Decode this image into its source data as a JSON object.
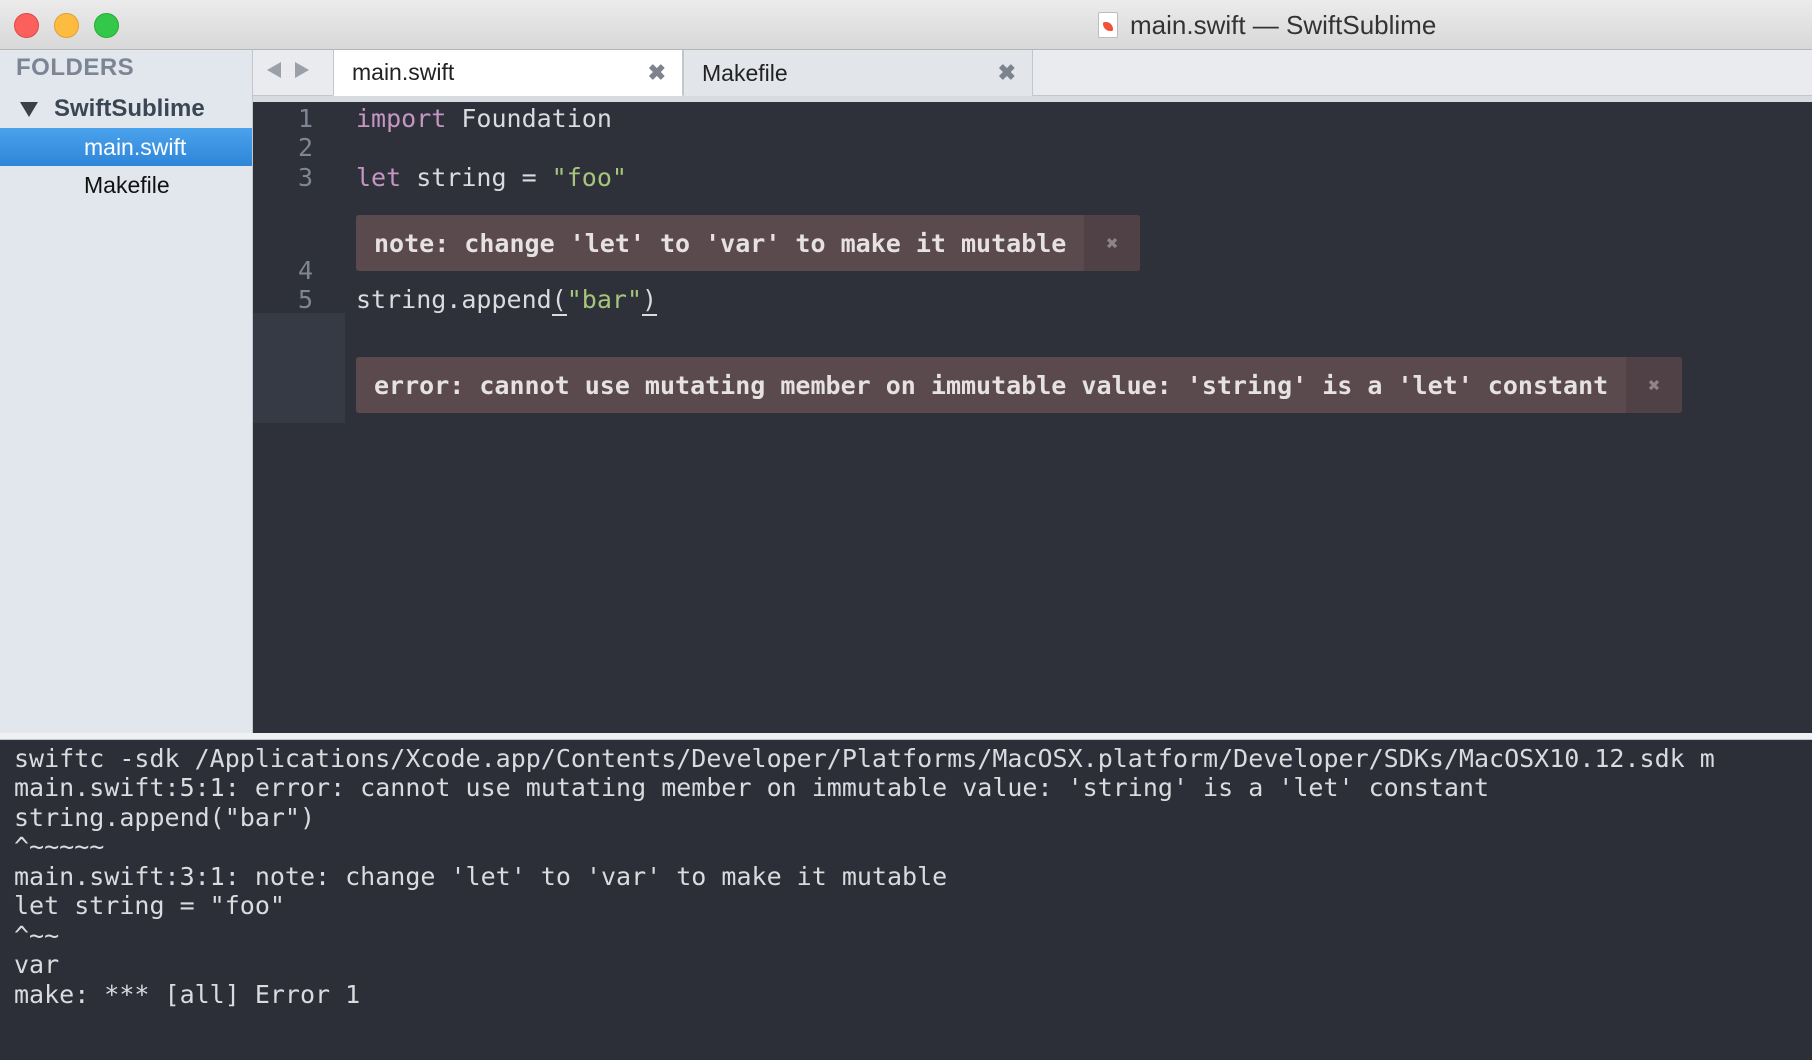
{
  "window": {
    "title": "main.swift — SwiftSublime"
  },
  "sidebar": {
    "header": "FOLDERS",
    "folder": "SwiftSublime",
    "files": [
      "main.swift",
      "Makefile"
    ]
  },
  "tabs": [
    {
      "label": "main.swift",
      "close": "✖"
    },
    {
      "label": "Makefile",
      "close": "✖"
    }
  ],
  "editor": {
    "lines": [
      {
        "num": "1",
        "kw": "import",
        "rest": " Foundation"
      },
      {
        "num": "2"
      },
      {
        "num": "3",
        "kw": "let",
        "rest": " string = ",
        "str": "\"foo\""
      },
      {
        "num": "4"
      },
      {
        "num": "5",
        "pre": "string.append",
        "open": "(",
        "str": "\"bar\"",
        "close": ")"
      }
    ],
    "note": "note: change 'let' to 'var' to make it mutable",
    "error": "error: cannot use mutating member on immutable value: 'string' is a 'let' constant",
    "phantom_close": "✖"
  },
  "output": {
    "lines": [
      "swiftc -sdk /Applications/Xcode.app/Contents/Developer/Platforms/MacOSX.platform/Developer/SDKs/MacOSX10.12.sdk m",
      "main.swift:5:1: error: cannot use mutating member on immutable value: 'string' is a 'let' constant",
      "string.append(\"bar\")",
      "^~~~~~",
      "main.swift:3:1: note: change 'let' to 'var' to make it mutable",
      "let string = \"foo\"",
      "^~~",
      "var",
      "make: *** [all] Error 1"
    ]
  },
  "colors": {
    "editor_bg": "#2e313a",
    "keyword": "#c595c4",
    "string": "#a6c57a",
    "selection": "#3b8fe0",
    "annotation_bg": "#5a4a4d"
  }
}
